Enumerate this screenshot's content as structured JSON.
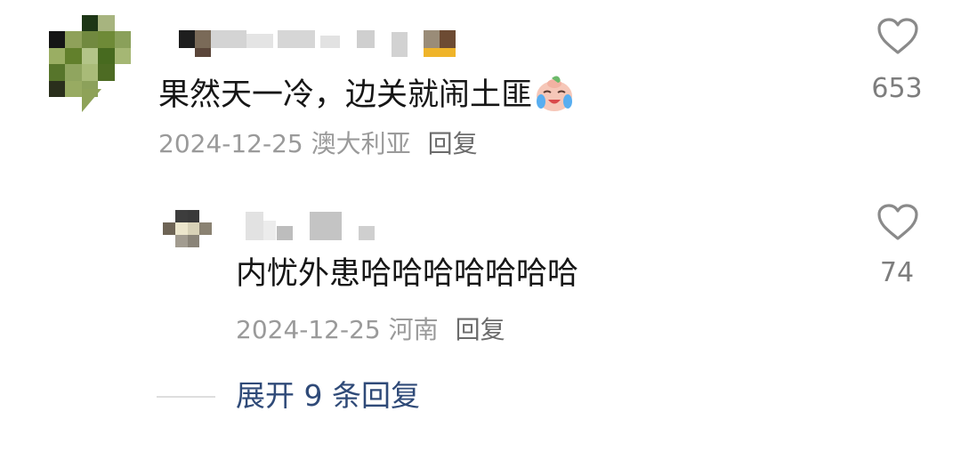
{
  "comment": {
    "text": "果然天一冷，边关就闹土匪",
    "emoji": "crying-face-emoji",
    "date": "2024-12-25",
    "location": "澳大利亚",
    "reply_label": "回复",
    "like_count": "653"
  },
  "reply": {
    "text": "内忧外患哈哈哈哈哈哈哈",
    "date": "2024-12-25",
    "location": "河南",
    "reply_label": "回复",
    "like_count": "74"
  },
  "expand": {
    "label": "展开 9 条回复"
  },
  "colors": {
    "text_primary": "#161616",
    "text_meta": "#9a9a9a",
    "link_blue": "#2f4a78",
    "icon_gray": "#8a8a8a"
  }
}
